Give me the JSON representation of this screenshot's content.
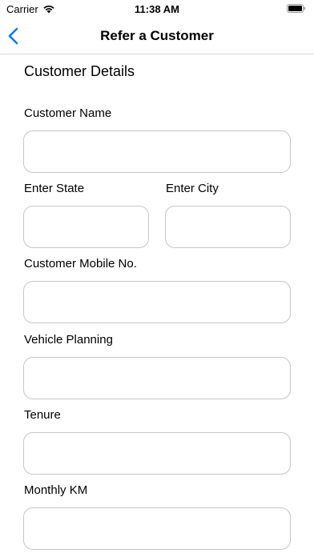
{
  "status_bar": {
    "carrier": "Carrier",
    "time": "11:38 AM"
  },
  "nav": {
    "title": "Refer a Customer",
    "back_icon": "chevron-left-icon"
  },
  "form": {
    "section_title": "Customer Details",
    "customer_name": {
      "label": "Customer Name",
      "value": ""
    },
    "state": {
      "label": "Enter State",
      "value": ""
    },
    "city": {
      "label": "Enter City",
      "value": ""
    },
    "mobile": {
      "label": "Customer Mobile No.",
      "value": ""
    },
    "vehicle_planning": {
      "label": "Vehicle Planning",
      "value": ""
    },
    "tenure": {
      "label": "Tenure",
      "value": ""
    },
    "monthly_km": {
      "label": "Monthly KM",
      "value": ""
    }
  },
  "colors": {
    "accent": "#0a7aff",
    "field_border": "#c7c7cc",
    "divider": "#d9d9d9"
  }
}
